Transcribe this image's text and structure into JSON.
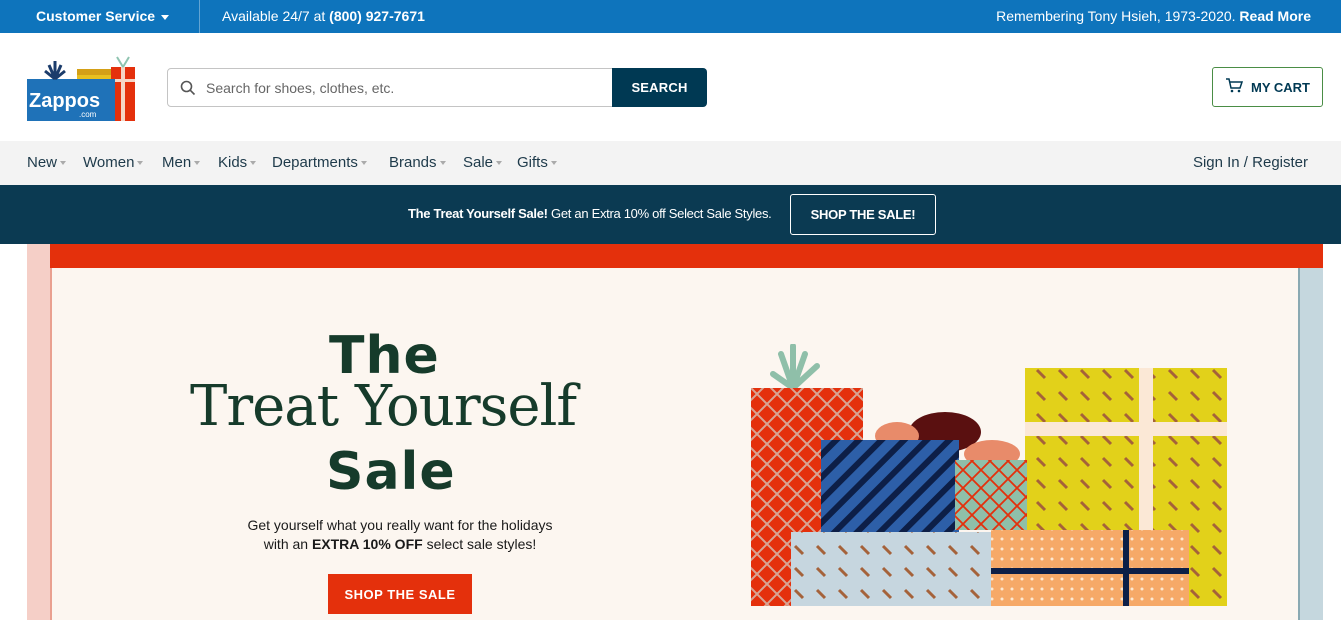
{
  "topbar": {
    "customer_service": "Customer Service",
    "available_prefix": "Available 24/7 at ",
    "phone": "(800) 927-7671",
    "remember_text": "Remembering Tony Hsieh, 1973-2020. ",
    "read_more": "Read More"
  },
  "header": {
    "logo_alt": "Zappos.com",
    "search_placeholder": "Search for shoes, clothes, etc.",
    "search_button": "SEARCH",
    "cart_label": "MY CART"
  },
  "nav": {
    "items": [
      {
        "label": "New"
      },
      {
        "label": "Women"
      },
      {
        "label": "Men"
      },
      {
        "label": "Kids"
      },
      {
        "label": "Departments"
      },
      {
        "label": "Brands"
      },
      {
        "label": "Sale"
      },
      {
        "label": "Gifts"
      }
    ],
    "signin": "Sign In / Register"
  },
  "promo": {
    "bold": "The Treat Yourself Sale!",
    "text": " Get an Extra 10% off Select Sale Styles.",
    "button": "SHOP THE SALE!"
  },
  "banner": {
    "line1": "The",
    "line2": "Treat Yourself",
    "line3": "Sale",
    "sub_line1": "Get yourself what you really want for the holidays",
    "sub_line2_pre": "with an ",
    "sub_line2_bold": "EXTRA 10% OFF",
    "sub_line2_post": " select sale styles!",
    "button": "SHOP THE SALE"
  },
  "colors": {
    "topbar": "#0e74bc",
    "navy": "#003953",
    "promo": "#0b3a52",
    "red": "#e4300c",
    "heading": "#163b2b"
  }
}
